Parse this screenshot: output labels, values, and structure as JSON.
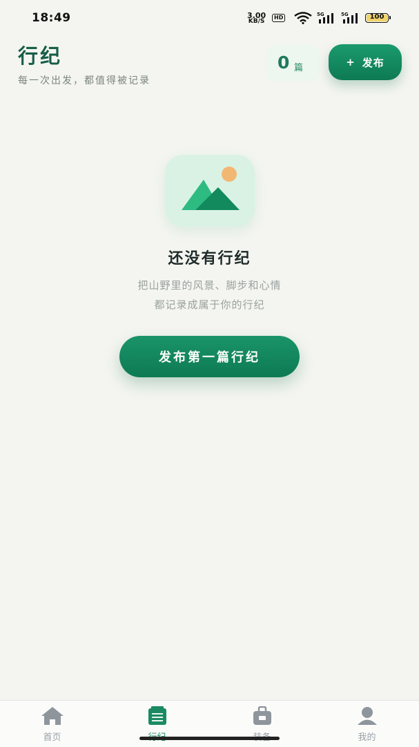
{
  "status_bar": {
    "time": "18:49",
    "net_speed_value": "3.00",
    "net_speed_unit": "KB/S",
    "hd_label": "HD",
    "signal1_label": "5G",
    "signal2_label": "5G",
    "battery": "100"
  },
  "header": {
    "title": "行纪",
    "subtitle": "每一次出发，都值得被记录",
    "count_value": "0",
    "count_unit": "篇",
    "publish_plus": "+",
    "publish_label": "发布"
  },
  "empty_state": {
    "title": "还没有行纪",
    "desc_line1": "把山野里的风景、脚步和心情",
    "desc_line2": "都记录成属于你的行纪",
    "button_label": "发布第一篇行纪"
  },
  "tabs": [
    {
      "label": "首页",
      "icon": "home-icon"
    },
    {
      "label": "行纪",
      "icon": "journal-icon"
    },
    {
      "label": "装备",
      "icon": "bag-icon"
    },
    {
      "label": "我的",
      "icon": "user-icon"
    }
  ],
  "colors": {
    "brand_green": "#0f7d57",
    "background": "#f4f5f0",
    "tab_active": "#1b8a63",
    "tab_inactive": "#9aa0a6"
  }
}
